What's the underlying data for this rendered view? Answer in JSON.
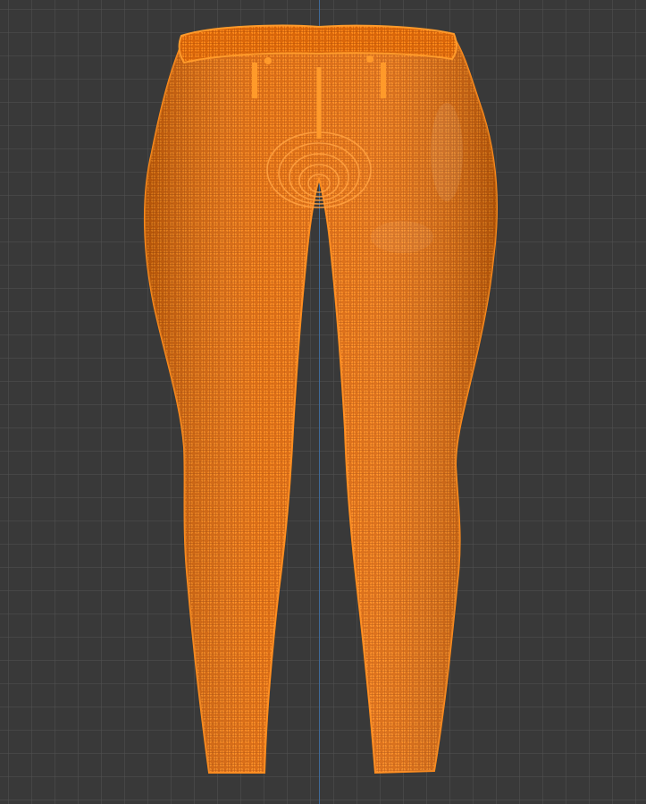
{
  "viewport": {
    "background_color": "#393939",
    "grid_color": "#4f4f4f",
    "axis_color": "#3f6a99",
    "grid": true
  },
  "object": {
    "name": "",
    "type": "mesh",
    "mode": "edit-vertex-select",
    "selection_color": "#ff7a00",
    "shape": "leggings"
  }
}
